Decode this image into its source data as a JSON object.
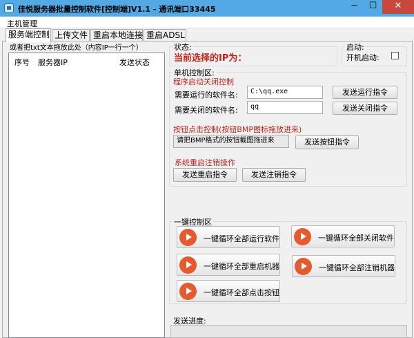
{
  "window": {
    "title": "佳悦服务器批量控制软件[控制端]V1.1 - 通讯端口33445",
    "min_label": "─",
    "max_label": "☐",
    "close_label": "✕"
  },
  "menu": {
    "item": "主机管理"
  },
  "tabs": [
    {
      "label": "服务端控制",
      "active": true
    },
    {
      "label": "上传文件",
      "active": false
    },
    {
      "label": "重启本地连接",
      "active": false
    },
    {
      "label": "重启ADSL",
      "active": false
    }
  ],
  "left": {
    "hint": "或者把txt文本拖放此处（内容IP一行一个）",
    "columns": [
      "序号",
      "服务器IP",
      "发送状态"
    ]
  },
  "status": {
    "group_title": "状态:",
    "current_ip_label": "当前选择的IP为："
  },
  "startup": {
    "group_title": "启动:",
    "checkbox_label": "开机启动:"
  },
  "single_control": {
    "group_title": "单机控制区:",
    "program_section": "程序启动关闭控制",
    "run_label": "需要运行的软件名:",
    "run_value": "C:\\qq.exe",
    "run_button": "发送运行指令",
    "close_label": "需要关闭的软件名:",
    "close_value": "qq",
    "close_button": "发送关闭指令",
    "button_section": "按钮点击控制(按钮BMP图标拖放进来)",
    "button_field": "请把BMP格式的按钮截图拖进来",
    "button_send": "发送按钮指令",
    "system_section": "系统重启注销操作",
    "restart_button": "发送重启指令",
    "logoff_button": "发送注销指令"
  },
  "onekey": {
    "group_title": "一键控制区",
    "run_all": "一键循环全部运行软件",
    "close_all": "一键循环全部关闭软件",
    "restart_all": "一键循环全部重启机器",
    "logoff_all": "一键循环全部注销机器",
    "click_all": "一键循环全部点击按钮"
  },
  "progress": {
    "label": "发送进度:"
  },
  "colors": {
    "titlebar": "#52a9e3",
    "accent_red": "#c0241d",
    "play_orange": "#e45b30"
  }
}
